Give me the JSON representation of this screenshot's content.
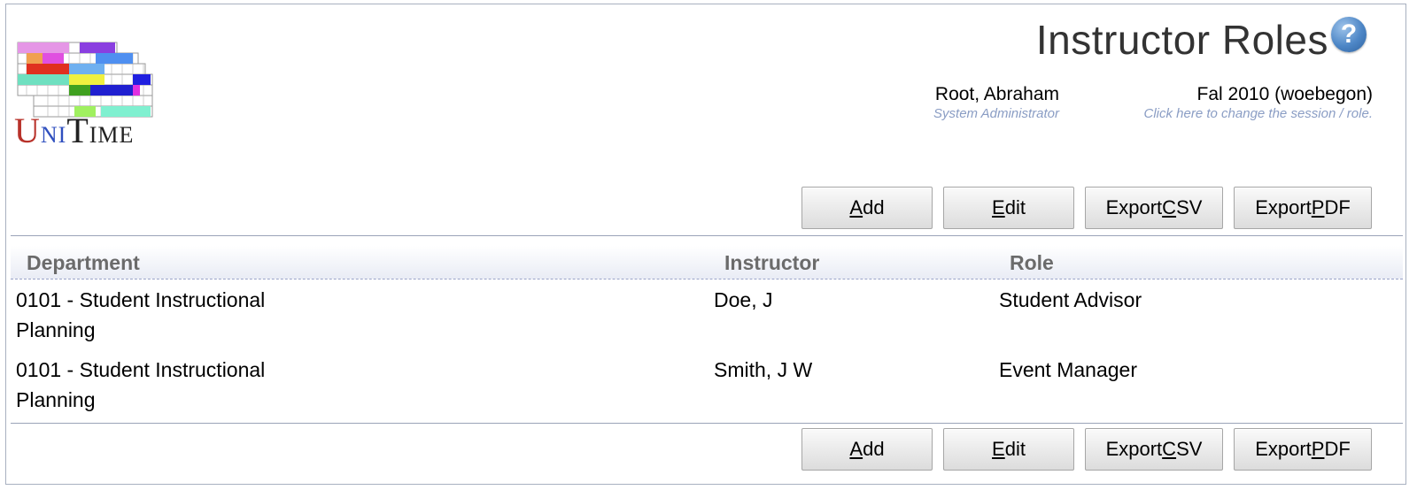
{
  "header": {
    "title": "Instructor Roles",
    "help_label": "?",
    "user": {
      "name": "Root, Abraham",
      "role": "System Administrator"
    },
    "session": {
      "name": "Fal 2010 (woebegon)",
      "hint": "Click here to change the session / role."
    }
  },
  "logo": {
    "text": "UniTime"
  },
  "buttons": {
    "add_label": "Add",
    "edit_label": "Edit",
    "export_csv_label": "Export CSV",
    "export_pdf_label": "Export PDF"
  },
  "table": {
    "columns": [
      "Department",
      "Instructor",
      "Role"
    ],
    "rows": [
      {
        "department": "0101 - Student Instructional Planning",
        "instructor": "Doe, J",
        "role": "Student Advisor"
      },
      {
        "department": "0101 - Student Instructional Planning",
        "instructor": "Smith, J W",
        "role": "Event Manager"
      }
    ]
  }
}
